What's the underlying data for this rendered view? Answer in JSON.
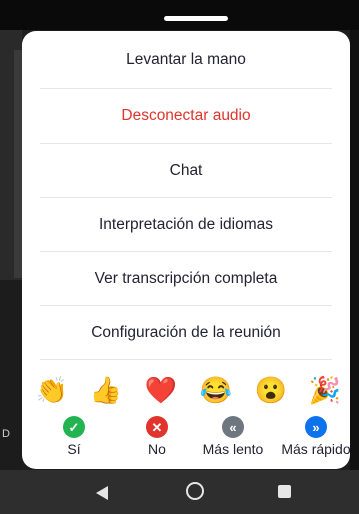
{
  "menu": {
    "items": [
      {
        "label": "Levantar la mano",
        "color": "#232333"
      },
      {
        "label": "Desconectar audio",
        "color": "#e0342c"
      },
      {
        "label": "Chat",
        "color": "#232333"
      },
      {
        "label": "Interpretación de idiomas",
        "color": "#232333"
      },
      {
        "label": "Ver transcripción completa",
        "color": "#232333"
      },
      {
        "label": "Configuración de la reunión",
        "color": "#232333"
      }
    ]
  },
  "reactions": [
    {
      "icon": "clapping-hands-icon",
      "glyph": "👏"
    },
    {
      "icon": "thumbs-up-icon",
      "glyph": "👍"
    },
    {
      "icon": "heart-icon",
      "glyph": "❤️"
    },
    {
      "icon": "tears-of-joy-icon",
      "glyph": "😂"
    },
    {
      "icon": "surprised-face-icon",
      "glyph": "😮"
    },
    {
      "icon": "party-popper-icon",
      "glyph": "🎉"
    }
  ],
  "feedback": [
    {
      "label": "Sí",
      "icon": "check-icon",
      "glyph": "✓",
      "color": "#23b351"
    },
    {
      "label": "No",
      "icon": "close-icon",
      "glyph": "✕",
      "color": "#e0342c"
    },
    {
      "label": "Más lento",
      "icon": "slower-icon",
      "glyph": "«",
      "color": "#6e7680"
    },
    {
      "label": "Más rápido",
      "icon": "faster-icon",
      "glyph": "»",
      "color": "#0e72ed"
    }
  ],
  "background": {
    "side_text": "D"
  }
}
